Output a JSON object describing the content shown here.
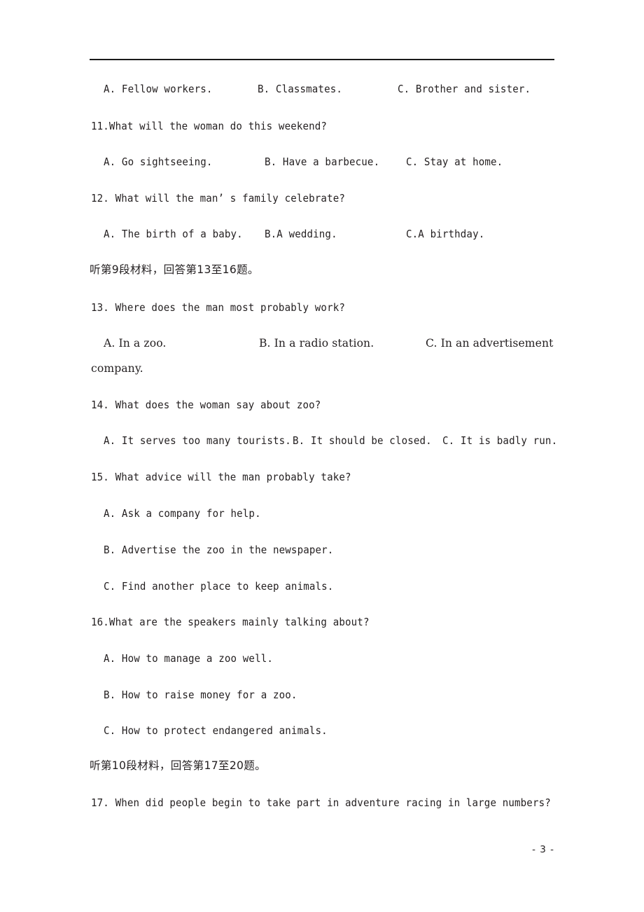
{
  "page": {
    "footer_label": "- 3 -",
    "rule_color": "#1a1a1a",
    "text_color": "#231f20",
    "background": "#ffffff"
  },
  "content": {
    "q10_options": {
      "a": "A. Fellow workers.",
      "b": "B. Classmates.",
      "c": "C. Brother and sister."
    },
    "q11": {
      "stem": "11.What will the woman do this weekend?",
      "a": "A. Go sightseeing.",
      "b": "B. Have a barbecue.",
      "c": "C. Stay at home."
    },
    "q12": {
      "stem": "12. What will the man’ s family celebrate?",
      "a": "A. The birth of a baby.",
      "b": "B.A wedding.",
      "c": "C.A birthday."
    },
    "section_9": "听第9段材料，回答第13至16题。",
    "q13": {
      "stem": "13. Where does the man most probably work?",
      "a": "A. In a zoo.",
      "b": "B. In a radio station.",
      "c": "C. In an advertisement",
      "c_wrap": "company."
    },
    "q14": {
      "stem": "14. What does the woman say about zoo?",
      "a": "A. It serves too many tourists.",
      "b": "B. It should be closed.",
      "c": "C. It is badly run."
    },
    "q15": {
      "stem": "15. What advice will the man probably take?",
      "a": "A. Ask a company for help.",
      "b": "B. Advertise the zoo in the newspaper.",
      "c": "C. Find another place to keep animals."
    },
    "q16": {
      "stem": "16.What are the speakers mainly talking about?",
      "a": "A. How to manage a zoo well.",
      "b": "B. How to raise money for a zoo.",
      "c": "C. How to protect endangered animals."
    },
    "section_10": "听第10段材料，回答第17至20题。",
    "q17": {
      "stem": "17. When did people begin to take part in adventure racing in large numbers?"
    }
  }
}
